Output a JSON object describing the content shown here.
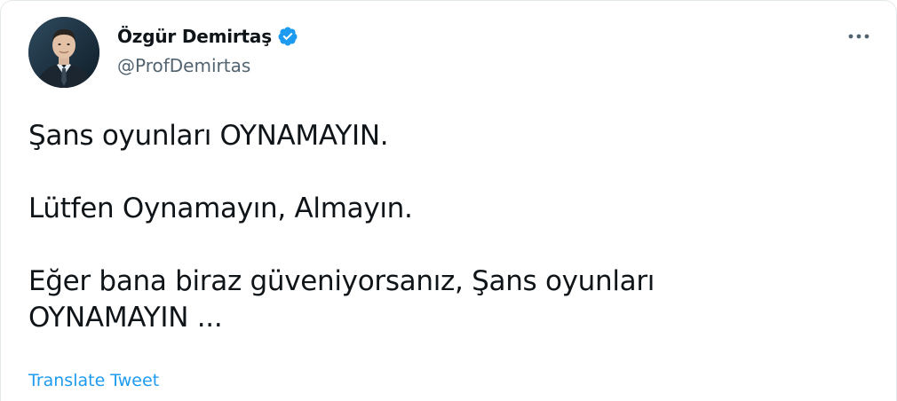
{
  "author": {
    "display_name": "Özgür Demirtaş",
    "handle": "@ProfDemirtas",
    "verified": true,
    "avatar_icon": "profile-photo"
  },
  "tweet": {
    "lines": [
      "Şans oyunları OYNAMAYIN.",
      "Lütfen Oynamayın, Almayın.",
      "Eğer bana biraz güveniyorsanız, Şans oyunları",
      "OYNAMAYIN ..."
    ]
  },
  "actions": {
    "translate_label": "Translate Tweet",
    "more_icon": "more-horizontal-icon"
  },
  "colors": {
    "text": "#0f1419",
    "secondary": "#536471",
    "accent": "#1d9bf0"
  }
}
